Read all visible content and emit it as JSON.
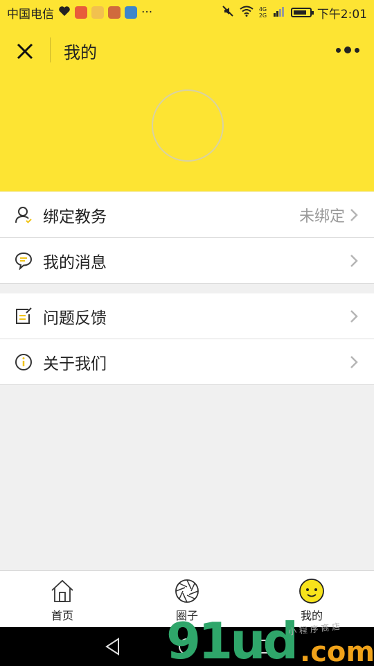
{
  "status_bar": {
    "carrier": "中国电信",
    "more": "···",
    "time": "下午2:01",
    "network": "4G 2G"
  },
  "header": {
    "title": "我的",
    "bg_color": "#fde433"
  },
  "menu": {
    "group1": [
      {
        "label": "绑定教务",
        "value": "未绑定",
        "icon": "user-check-icon"
      },
      {
        "label": "我的消息",
        "value": "",
        "icon": "chat-bubble-icon"
      }
    ],
    "group2": [
      {
        "label": "问题反馈",
        "value": "",
        "icon": "edit-note-icon"
      },
      {
        "label": "关于我们",
        "value": "",
        "icon": "info-icon"
      }
    ]
  },
  "tabs": [
    {
      "label": "首页",
      "icon": "home-icon"
    },
    {
      "label": "圈子",
      "icon": "aperture-icon"
    },
    {
      "label": "我的",
      "icon": "smiley-icon",
      "active": true
    }
  ],
  "watermark": {
    "main": "91ud",
    "suffix": ".com",
    "small": "小 程 序 商 店"
  }
}
